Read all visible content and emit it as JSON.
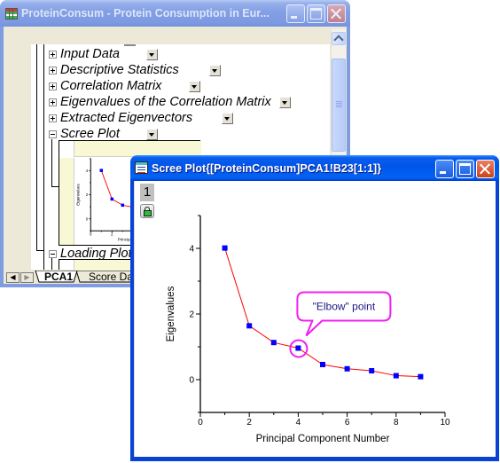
{
  "main_window": {
    "title": "ProteinConsum - Protein Consumption in Eur...",
    "state": "inactive",
    "tree_items": [
      {
        "label": "Input Data",
        "expander": "plus"
      },
      {
        "label": "Descriptive Statistics",
        "expander": "plus"
      },
      {
        "label": "Correlation Matrix",
        "expander": "plus"
      },
      {
        "label": "Eigenvalues of the Correlation Matrix",
        "expander": "plus"
      },
      {
        "label": "Extracted Eigenvectors",
        "expander": "plus"
      },
      {
        "label": "Scree Plot",
        "expander": "minus"
      }
    ],
    "loading_plot": {
      "label": "Loading Plot",
      "expander": "minus"
    },
    "sheet_nav": {
      "prev": "◀",
      "next": "▶"
    },
    "sheet_tabs": [
      {
        "label": "PCA1",
        "active": true
      },
      {
        "label": "Score Da",
        "active": false
      }
    ]
  },
  "graph_window": {
    "title": "Scree Plot{[ProteinConsum]PCA1!B23[1:1]}",
    "state": "active",
    "layer_label": "1"
  },
  "colors": {
    "line": "#FF0000",
    "marker": "#0000FF",
    "annotation": "#F020F0",
    "annotation_text": "#1A1A80",
    "embed_band": "#F8F8D4"
  },
  "chart_data": {
    "type": "line",
    "title": "",
    "xlabel": "Principal Component Number",
    "ylabel": "Eigenvalues",
    "x": [
      1,
      2,
      3,
      4,
      5,
      6,
      7,
      8,
      9
    ],
    "series": [
      {
        "name": "Eigenvalues",
        "values": [
          4.01,
          1.64,
          1.13,
          0.96,
          0.46,
          0.33,
          0.27,
          0.12,
          0.09
        ],
        "line_color": "#FF0000",
        "marker": "square",
        "marker_color": "#0000FF"
      }
    ],
    "xlim": [
      0,
      10
    ],
    "ylim": [
      -1,
      5
    ],
    "xticks": [
      0,
      2,
      4,
      6,
      8,
      10
    ],
    "xtick_labels": [
      "0",
      "2",
      "4",
      "6",
      "8",
      "10"
    ],
    "yticks": [
      0,
      2,
      4
    ],
    "ytick_labels": [
      "0",
      "2",
      "4"
    ],
    "x_minor_step": 1,
    "y_minor_step": 1,
    "grid": false,
    "legend": "none",
    "annotations": [
      {
        "text": "\"Elbow\" point",
        "target_x": 4,
        "target_y": 0.96,
        "style": "callout-with-circle"
      }
    ]
  }
}
